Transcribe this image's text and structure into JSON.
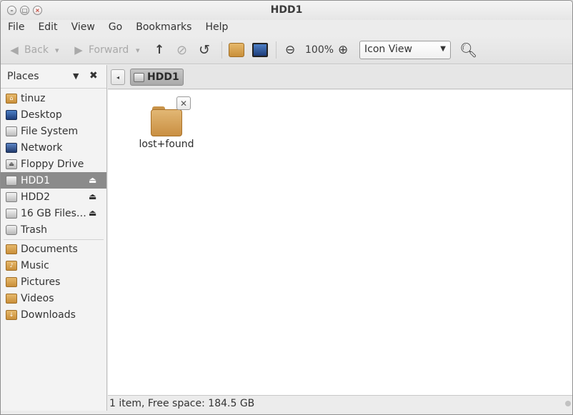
{
  "window": {
    "title": "HDD1"
  },
  "menubar": [
    "File",
    "Edit",
    "View",
    "Go",
    "Bookmarks",
    "Help"
  ],
  "toolbar": {
    "back_label": "Back",
    "forward_label": "Forward",
    "zoom_level": "100%",
    "view_mode": "Icon View"
  },
  "icons": {
    "back": "◀",
    "forward": "▶",
    "dropdown": "▾",
    "up": "↑",
    "stop": "⃠",
    "reload": "↺",
    "zoom_out": "⊖",
    "zoom_in": "⊕",
    "search": "⚲",
    "close": "✖",
    "eject": "⏏",
    "collapse": "◂",
    "emblem_x": "✕"
  },
  "sidebar": {
    "header": "Places",
    "items": [
      {
        "label": "tinuz",
        "icon": "home-folder-icon"
      },
      {
        "label": "Desktop",
        "icon": "desktop-icon"
      },
      {
        "label": "File System",
        "icon": "drive-icon"
      },
      {
        "label": "Network",
        "icon": "network-icon"
      },
      {
        "label": "Floppy Drive",
        "icon": "floppy-icon"
      },
      {
        "label": "HDD1",
        "icon": "drive-icon",
        "selected": true,
        "eject": true
      },
      {
        "label": "HDD2",
        "icon": "drive-icon",
        "eject": true
      },
      {
        "label": "16 GB Files…",
        "icon": "drive-icon",
        "eject": true
      },
      {
        "label": "Trash",
        "icon": "trash-icon"
      }
    ],
    "bookmarks": [
      {
        "label": "Documents",
        "icon": "documents-folder-icon"
      },
      {
        "label": "Music",
        "icon": "music-folder-icon"
      },
      {
        "label": "Pictures",
        "icon": "pictures-folder-icon"
      },
      {
        "label": "Videos",
        "icon": "videos-folder-icon"
      },
      {
        "label": "Downloads",
        "icon": "downloads-folder-icon"
      }
    ]
  },
  "location": {
    "crumb": "HDD1"
  },
  "content": {
    "items": [
      {
        "name": "lost+found",
        "icon": "folder-icon"
      }
    ]
  },
  "status": {
    "text": "1 item, Free space: 184.5 GB"
  },
  "colors": {
    "selection": "#8b8b8b",
    "folder": "#d9a85e",
    "background": "#ffffff"
  }
}
